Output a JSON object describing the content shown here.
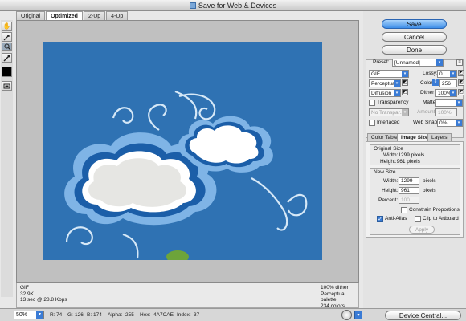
{
  "window": {
    "title": "Save for Web & Devices"
  },
  "view_tabs": [
    "Original",
    "Optimized",
    "2-Up",
    "4-Up"
  ],
  "active_view_tab": "Optimized",
  "tools": [
    "hand-icon",
    "slice-select-icon",
    "zoom-icon",
    "eyedropper-icon",
    "eyedropper-color-swatch",
    "toggle-slices-icon"
  ],
  "info_left": [
    "GIF",
    "32.9K",
    "13 sec @ 28.8 Kbps"
  ],
  "info_right": [
    "100% dither",
    "Perceptual palette",
    "234 colors"
  ],
  "status": {
    "zoom": "50%",
    "R_label": "R:",
    "R": "74",
    "G_label": "G:",
    "G": "126",
    "B_label": "B:",
    "B": "174",
    "alpha_label": "Alpha:",
    "alpha": "255",
    "hex_label": "Hex:",
    "hex": "4A7CAE",
    "index_label": "Index:",
    "index": "37"
  },
  "buttons": {
    "save": "Save",
    "cancel": "Cancel",
    "done": "Done",
    "device_central": "Device Central...",
    "apply": "Apply"
  },
  "settings": {
    "preset_label": "Preset:",
    "preset": "[Unnamed]",
    "format": "GIF",
    "lossy_label": "Lossy:",
    "lossy": "0",
    "reduction": "Perceptual",
    "colors_label": "Colors:",
    "colors": "256",
    "dither_algo": "Diffusion",
    "dither_label": "Dither:",
    "dither": "100%",
    "transparency_label": "Transparency",
    "matte_label": "Matte:",
    "transparency_dither": "No Transpar...",
    "amount_label": "Amount:",
    "amount": "100%",
    "interlaced_label": "Interlaced",
    "websnap_label": "Web Snap:",
    "websnap": "0%"
  },
  "image_tabs": [
    "Color Table",
    "Image Size",
    "Layers"
  ],
  "active_image_tab": "Image Size",
  "image_size": {
    "original_title": "Original Size",
    "orig_width": "Width:1299 pixels",
    "orig_height": "Height:961 pixels",
    "new_title": "New Size",
    "width_label": "Width:",
    "width": "1299",
    "width_unit": "pixels",
    "height_label": "Height:",
    "height": "961",
    "height_unit": "pixels",
    "percent_label": "Percent:",
    "percent": "100",
    "constrain_label": "Constrain Proportions",
    "antialias_label": "Anti-Alias",
    "clip_label": "Clip to Artboard"
  },
  "colors": {
    "sky": "#2f72b3",
    "accent": "#3a7bd5",
    "pixel_hex": "#4A7CAE"
  }
}
